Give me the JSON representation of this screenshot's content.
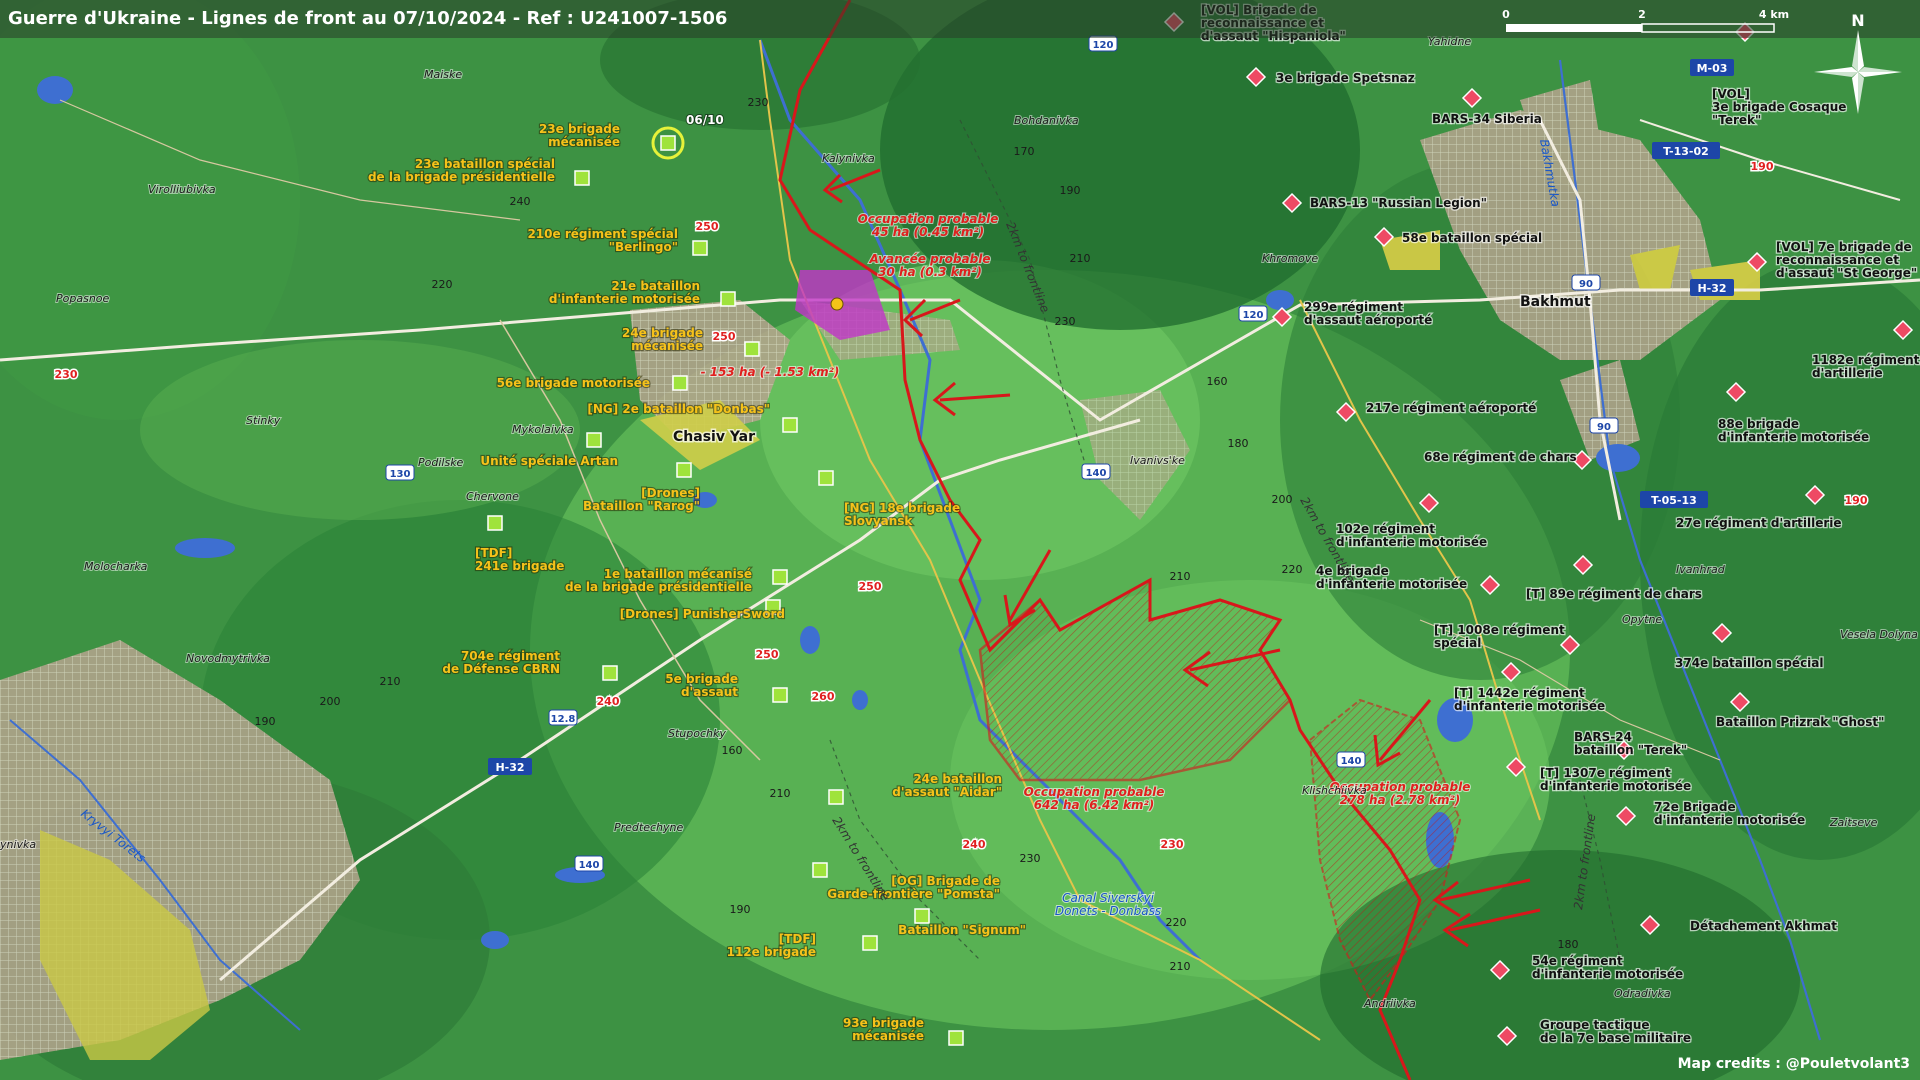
{
  "title": "Guerre d'Ukraine - Lignes de front au 07/10/2024 - Ref : U241007-1506",
  "credits": "Map credits : @Pouletvolant3",
  "colors": {
    "front_line": "#d8171b",
    "ukrainian_label": "#f6c21a",
    "russian_unit": "#ee4a64",
    "ukrainian_unit": "#9fe33c",
    "water": "#3e6fd1"
  },
  "scale": {
    "labels": [
      "0",
      "2",
      "4 km"
    ]
  },
  "north": "N",
  "date_marker": "06/10",
  "road_shields": {
    "blue": [
      "120",
      "120",
      "140",
      "140",
      "130",
      "90",
      "90",
      "140",
      "12.8"
    ],
    "route": [
      "M-03",
      "T-13-02",
      "H-32",
      "T-05-13",
      "H-32"
    ]
  },
  "road_numbers": [
    "230",
    "250",
    "250",
    "250",
    "250",
    "260",
    "240",
    "240",
    "230",
    "190",
    "190"
  ],
  "elevations": [
    "230",
    "240",
    "220",
    "170",
    "190",
    "210",
    "230",
    "160",
    "180",
    "200",
    "210",
    "220",
    "200",
    "210",
    "190",
    "160",
    "210",
    "190",
    "230",
    "220",
    "210",
    "180"
  ],
  "settlements": {
    "cities": [
      "Chasiv Yar",
      "Bakhmut"
    ],
    "towns": [
      "Maiske",
      "Virolliubivka",
      "Popasnoe",
      "Stinky",
      "Podilske",
      "Mykolaivka",
      "Chervone",
      "Molocharka",
      "Novodmytrivka",
      "Stupochky",
      "Predtechyne",
      "Kalynivka",
      "Bohdanivka",
      "Khromove",
      "Yahidne",
      "Ivanivs'ke",
      "Klishchiivka",
      "Andriivka",
      "Opytne",
      "Ivanhrad",
      "Vesela Dolyna",
      "Zaitseve",
      "Odradivka",
      "ynivka"
    ]
  },
  "waterways": {
    "canal": [
      "Canal Siverskyi",
      "Donets - Donbass"
    ],
    "river1": "Bakhmutka",
    "river2": "Kryvyi Torets"
  },
  "distance_marks": [
    "2km to frontline",
    "2km to frontline",
    "2km to frontline",
    "2km to frontline"
  ],
  "annotations": [
    {
      "lines": [
        "Occupation probable",
        "45 ha (0.45 km²)"
      ]
    },
    {
      "lines": [
        "Avancée probable",
        "30 ha (0.3 km²)"
      ]
    },
    {
      "lines": [
        "- 153 ha (- 1.53 km²)"
      ]
    },
    {
      "lines": [
        "Occupation probable",
        "642 ha (6.42 km²)"
      ]
    },
    {
      "lines": [
        "Occupation probable",
        "278 ha (2.78 km²)"
      ]
    }
  ],
  "ukrainian_units": [
    {
      "lines": [
        "23e brigade",
        "mécanisée"
      ]
    },
    {
      "lines": [
        "23e bataillon spécial",
        "de la brigade présidentielle"
      ]
    },
    {
      "lines": [
        "210e régiment spécial",
        "\"Berlingo\""
      ]
    },
    {
      "lines": [
        "21e bataillon",
        "d'infanterie motorisée"
      ]
    },
    {
      "lines": [
        "24e brigade",
        "mécanisée"
      ]
    },
    {
      "lines": [
        "56e brigade motorisée"
      ]
    },
    {
      "lines": [
        "[NG] 2e bataillon \"Donbas\""
      ]
    },
    {
      "lines": [
        "Unité spéciale Artan"
      ]
    },
    {
      "lines": [
        "[Drones]",
        "Bataillon \"Rarog\""
      ]
    },
    {
      "lines": [
        "[NG] 18e brigade",
        "Slovyansk"
      ]
    },
    {
      "lines": [
        "[TDF]",
        "241e brigade"
      ]
    },
    {
      "lines": [
        "1e bataillon mécanisé",
        "de la brigade présidentielle"
      ]
    },
    {
      "lines": [
        "[Drones] PunisherSword"
      ]
    },
    {
      "lines": [
        "704e régiment",
        "de Défense CBRN"
      ]
    },
    {
      "lines": [
        "5e brigade",
        "d'assaut"
      ]
    },
    {
      "lines": [
        "24e bataillon",
        "d'assaut \"Aidar\""
      ]
    },
    {
      "lines": [
        "[OG] Brigade de",
        "Garde-frontière \"Pomsta\""
      ]
    },
    {
      "lines": [
        "[TDF]",
        "112e brigade"
      ]
    },
    {
      "lines": [
        "Bataillon \"Signum\""
      ]
    },
    {
      "lines": [
        "93e brigade",
        "mécanisée"
      ]
    }
  ],
  "russian_units": [
    {
      "lines": [
        "[VOL] Brigade de",
        "reconnaissance et",
        "d'assaut \"Hispaniola\""
      ]
    },
    {
      "lines": [
        "3e brigade Spetsnaz"
      ]
    },
    {
      "lines": [
        "BARS-34 Siberia"
      ]
    },
    {
      "lines": [
        "[VOL]",
        "3e brigade Cosaque",
        "\"Terek\""
      ]
    },
    {
      "lines": [
        "BARS-13 \"Russian Legion\""
      ]
    },
    {
      "lines": [
        "58e bataillon spécial"
      ]
    },
    {
      "lines": [
        "[VOL] 7e brigade de",
        "reconnaissance et",
        "d'assaut \"St George\""
      ]
    },
    {
      "lines": [
        "299e régiment",
        "d'assaut aéroporté"
      ]
    },
    {
      "lines": [
        "1182e régiment",
        "d'artillerie"
      ]
    },
    {
      "lines": [
        "217e régiment aéroporté"
      ]
    },
    {
      "lines": [
        "88e brigade",
        "d'infanterie motorisée"
      ]
    },
    {
      "lines": [
        "68e régiment de chars"
      ]
    },
    {
      "lines": [
        "102e régiment",
        "d'infanterie motorisée"
      ]
    },
    {
      "lines": [
        "27e régiment d'artillerie"
      ]
    },
    {
      "lines": [
        "4e brigade",
        "d'infanterie motorisée"
      ]
    },
    {
      "lines": [
        "[T] 89e régiment de chars"
      ]
    },
    {
      "lines": [
        "[T] 1008e régiment",
        "spécial"
      ]
    },
    {
      "lines": [
        "374e bataillon spécial"
      ]
    },
    {
      "lines": [
        "[T] 1442e régiment",
        "d'infanterie motorisée"
      ]
    },
    {
      "lines": [
        "Bataillon Prizrak \"Ghost\""
      ]
    },
    {
      "lines": [
        "BARS-24",
        "bataillon \"Terek\""
      ]
    },
    {
      "lines": [
        "[T] 1307e régiment",
        "d'infanterie motorisée"
      ]
    },
    {
      "lines": [
        "72e Brigade",
        "d'infanterie motorisée"
      ]
    },
    {
      "lines": [
        "Détachement Akhmat"
      ]
    },
    {
      "lines": [
        "54e régiment",
        "d'infanterie motorisée"
      ]
    },
    {
      "lines": [
        "Groupe tactique",
        "de la 7e base militaire"
      ]
    }
  ]
}
